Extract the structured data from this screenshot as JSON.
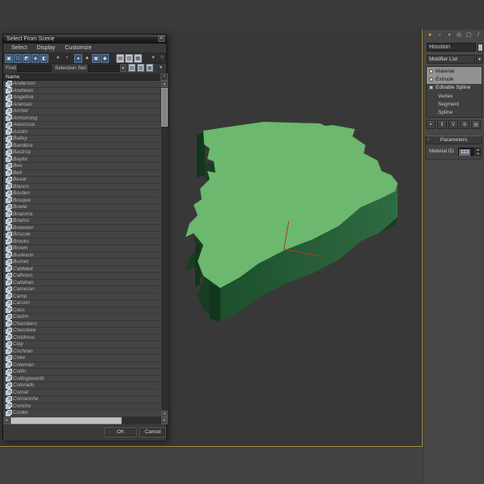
{
  "app": {
    "viewport_bg": "#383838",
    "panel_bg": "#474747",
    "viewport_border": "#9d9040"
  },
  "dialog": {
    "title": "Select From Scene",
    "menu": [
      "Select",
      "Display",
      "Customize"
    ],
    "toolbar": [
      {
        "name": "display-all-icon",
        "glyph": "▣",
        "style": "tb-on",
        "fg": "#cfe0f0"
      },
      {
        "name": "display-none-icon",
        "glyph": "□",
        "style": "tb-on",
        "fg": "#cfe0f0"
      },
      {
        "name": "display-inverted-icon",
        "glyph": "◩",
        "style": "tb-on",
        "fg": "#cfe0f0"
      },
      {
        "name": "display-influences-icon",
        "glyph": "◈",
        "style": "tb-on",
        "fg": "#cfe0f0"
      },
      {
        "name": "display-geometry-icon",
        "glyph": "◧",
        "style": "tb-on",
        "fg": "#cfe0f0"
      },
      {
        "name": "sync-selection-icon",
        "glyph": "➤",
        "style": "tb-flat",
        "fg": "#a8a8a8",
        "gap": 6
      },
      {
        "name": "separator-dot-icon",
        "glyph": "•",
        "style": "tb-flat",
        "fg": "#a8a8a8"
      },
      {
        "name": "display-shapes-icon",
        "glyph": "●",
        "style": "tb-on",
        "fg": "#cfe0f0",
        "gap": 3
      },
      {
        "name": "display-lights-icon",
        "glyph": "▲",
        "style": "tb-flat",
        "fg": "#e8c35a"
      },
      {
        "name": "display-cameras-icon",
        "glyph": "▣",
        "style": "tb-on",
        "fg": "#cfe0f0"
      },
      {
        "name": "display-helpers-icon",
        "glyph": "◆",
        "style": "tb-on",
        "fg": "#cfe0f0"
      },
      {
        "name": "list-view-icon",
        "glyph": "▤",
        "style": "tb-page",
        "fg": "#333",
        "gap": 8
      },
      {
        "name": "column-view-icon",
        "glyph": "▥",
        "style": "tb-page",
        "fg": "#333"
      },
      {
        "name": "detail-view-icon",
        "glyph": "▦",
        "style": "tb-page",
        "fg": "#333"
      },
      {
        "name": "filter-funnel-icon",
        "glyph": "▼",
        "style": "tb-flat",
        "fg": "#9aa0a6",
        "gap": 8
      },
      {
        "name": "filter-funnel-config-icon",
        "glyph": "▽",
        "style": "tb-flat",
        "fg": "#9aa0a6"
      }
    ],
    "find_label": "Find:",
    "find_value": "",
    "selection_set_label": "Selection Set:",
    "selection_set_value": "",
    "selection_set_icons": [
      {
        "name": "edit-named-selections-icon",
        "glyph": "▤"
      },
      {
        "name": "copy-selection-set-icon",
        "glyph": "▥"
      },
      {
        "name": "paste-selection-set-icon",
        "glyph": "▦"
      }
    ],
    "column_header": "Name",
    "rows": [
      "Anderson",
      "Andrews",
      "Angelina",
      "Aransas",
      "Archer",
      "Armstrong",
      "Atascosa",
      "Austin",
      "Bailey",
      "Bandera",
      "Bastrop",
      "Baylor",
      "Bee",
      "Bell",
      "Bexar",
      "Blanco",
      "Borden",
      "Bosque",
      "Bowie",
      "Brazoria",
      "Brazos",
      "Brewster",
      "Briscoe",
      "Brooks",
      "Brown",
      "Burleson",
      "Burnet",
      "Caldwell",
      "Calhoun",
      "Callahan",
      "Cameron",
      "Camp",
      "Carson",
      "Cass",
      "Castro",
      "Chambers",
      "Cherokee",
      "Childress",
      "Clay",
      "Cochran",
      "Coke",
      "Coleman",
      "Collin",
      "Collingsworth",
      "Colorado",
      "Comal",
      "Comanche",
      "Concho",
      "Cooke"
    ],
    "ok_label": "OK",
    "cancel_label": "Cancel",
    "icons": {
      "close": "✕",
      "scroll_up": "▲",
      "scroll_down": "▼",
      "scroll_left": "◄",
      "scroll_right": "►",
      "dropdown": "▼",
      "column_options": "▪"
    }
  },
  "command_panel": {
    "tabs": [
      {
        "name": "tab-create-icon",
        "glyph": "●",
        "color": "#e8973d"
      },
      {
        "name": "tab-modify-icon",
        "glyph": "◖",
        "color": "#4d8fd6"
      },
      {
        "name": "tab-hierarchy-icon",
        "glyph": "▪",
        "color": "#c8c8c8"
      },
      {
        "name": "tab-motion-icon",
        "glyph": "◎",
        "color": "#b8b8b8"
      },
      {
        "name": "tab-display-icon",
        "glyph": "▢",
        "color": "#c0c0c0"
      },
      {
        "name": "tab-utilities-icon",
        "glyph": "/",
        "color": "#b0b0b0"
      }
    ],
    "object_name": "Houston",
    "modifier_list_label": "Modifier List",
    "stack": [
      {
        "label": "Material",
        "type": "modifier",
        "selected": true,
        "italic": false
      },
      {
        "label": "Extrude",
        "type": "modifier",
        "selected": true,
        "italic": true
      },
      {
        "label": "Editable Spline",
        "type": "base",
        "selected": false,
        "italic": false
      },
      {
        "label": "Vertex",
        "type": "subobject",
        "selected": false,
        "italic": false
      },
      {
        "label": "Segment",
        "type": "subobject",
        "selected": false,
        "italic": false
      },
      {
        "label": "Spline",
        "type": "subobject",
        "selected": false,
        "italic": false
      }
    ],
    "stack_buttons": [
      {
        "name": "pin-stack-icon",
        "glyph": "⌖"
      },
      {
        "name": "show-end-result-icon",
        "glyph": "‖"
      },
      {
        "name": "make-unique-icon",
        "glyph": "V"
      },
      {
        "name": "remove-modifier-icon",
        "glyph": "⊘"
      },
      {
        "name": "configure-modifier-sets-icon",
        "glyph": "▤"
      }
    ],
    "rollout": {
      "collapse_glyph": "-",
      "title": "Parameters",
      "material_id_label": "Material ID:",
      "material_id_value": "113",
      "spinner_up": "▲",
      "spinner_down": "▼"
    }
  },
  "viewport": {
    "object": "extruded county spline (Houston)",
    "colors": {
      "top": "#6cb86e",
      "side_light": "#2f6b42",
      "side_dark": "#1d4f2c",
      "base": "#173d22",
      "strip": "#12361d",
      "axis": "#b0392b"
    }
  }
}
